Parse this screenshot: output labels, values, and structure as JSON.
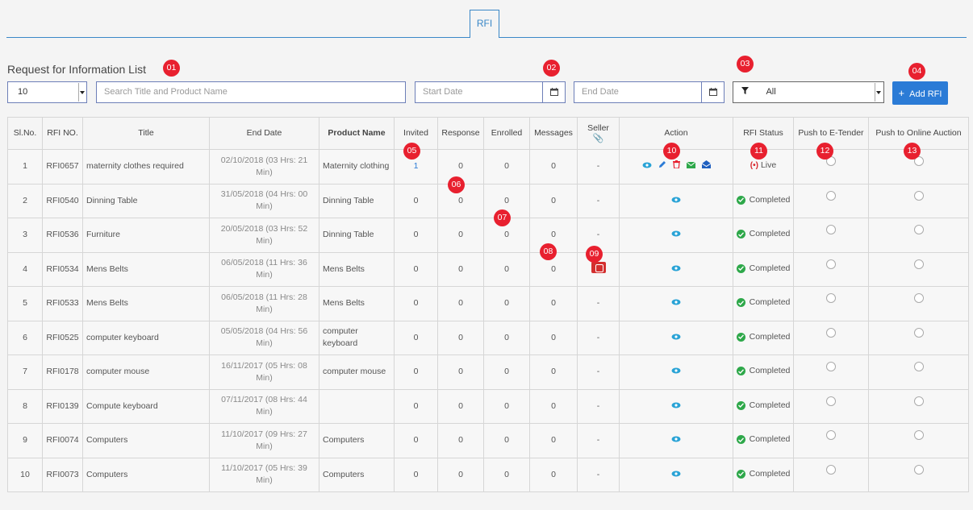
{
  "tab": {
    "label": "RFI"
  },
  "list_title": "Request for Information List",
  "controls": {
    "page_size": "10",
    "search_placeholder": "Search Title and Product Name",
    "start_placeholder": "Start Date",
    "end_placeholder": "End Date",
    "filter_value": "All",
    "add_button": "Add RFI"
  },
  "headers": {
    "slno": "Sl.No.",
    "rfi_no": "RFI NO.",
    "title": "Title",
    "end_date": "End Date",
    "product": "Product Name",
    "invited": "Invited",
    "response": "Response",
    "enrolled": "Enrolled",
    "messages": "Messages",
    "seller": "Seller",
    "action": "Action",
    "status": "RFI Status",
    "push_etender": "Push to E-Tender",
    "push_auction": "Push to Online Auction"
  },
  "rows": [
    {
      "sl": "1",
      "rfi": "RFI0657",
      "title": "maternity clothes required",
      "end": "02/10/2018 (03 Hrs: 21 Min)",
      "product": "Maternity clothing",
      "invited": "1",
      "response": "0",
      "enrolled": "0",
      "messages": "0",
      "seller": "-",
      "status": "Live"
    },
    {
      "sl": "2",
      "rfi": "RFI0540",
      "title": "Dinning Table",
      "end": "31/05/2018 (04 Hrs: 00 Min)",
      "product": "Dinning Table",
      "invited": "0",
      "response": "0",
      "enrolled": "0",
      "messages": "0",
      "seller": "-",
      "status": "Completed"
    },
    {
      "sl": "3",
      "rfi": "RFI0536",
      "title": "Furniture",
      "end": "20/05/2018 (03 Hrs: 52 Min)",
      "product": "Dinning Table",
      "invited": "0",
      "response": "0",
      "enrolled": "0",
      "messages": "0",
      "seller": "-",
      "status": "Completed"
    },
    {
      "sl": "4",
      "rfi": "RFI0534",
      "title": "Mens Belts",
      "end": "06/05/2018 (11 Hrs: 36 Min)",
      "product": "Mens Belts",
      "invited": "0",
      "response": "0",
      "enrolled": "0",
      "messages": "0",
      "seller": "",
      "status": "Completed"
    },
    {
      "sl": "5",
      "rfi": "RFI0533",
      "title": "Mens Belts",
      "end": "06/05/2018 (11 Hrs: 28 Min)",
      "product": "Mens Belts",
      "invited": "0",
      "response": "0",
      "enrolled": "0",
      "messages": "0",
      "seller": "-",
      "status": "Completed"
    },
    {
      "sl": "6",
      "rfi": "RFI0525",
      "title": "computer keyboard",
      "end": "05/05/2018 (04 Hrs: 56 Min)",
      "product": "computer keyboard",
      "invited": "0",
      "response": "0",
      "enrolled": "0",
      "messages": "0",
      "seller": "-",
      "status": "Completed"
    },
    {
      "sl": "7",
      "rfi": "RFI0178",
      "title": "computer mouse",
      "end": "16/11/2017 (05 Hrs: 08 Min)",
      "product": "computer mouse",
      "invited": "0",
      "response": "0",
      "enrolled": "0",
      "messages": "0",
      "seller": "-",
      "status": "Completed"
    },
    {
      "sl": "8",
      "rfi": "RFI0139",
      "title": "Compute keyboard",
      "end": "07/11/2017 (08 Hrs: 44 Min)",
      "product": "",
      "invited": "0",
      "response": "0",
      "enrolled": "0",
      "messages": "0",
      "seller": "-",
      "status": "Completed"
    },
    {
      "sl": "9",
      "rfi": "RFI0074",
      "title": "Computers",
      "end": "11/10/2017 (09 Hrs: 27 Min)",
      "product": "Computers",
      "invited": "0",
      "response": "0",
      "enrolled": "0",
      "messages": "0",
      "seller": "-",
      "status": "Completed"
    },
    {
      "sl": "10",
      "rfi": "RFI0073",
      "title": "Computers",
      "end": "11/10/2017 (05 Hrs: 39 Min)",
      "product": "Computers",
      "invited": "0",
      "response": "0",
      "enrolled": "0",
      "messages": "0",
      "seller": "-",
      "status": "Completed"
    }
  ],
  "markers": [
    "01",
    "02",
    "03",
    "04",
    "05",
    "06",
    "07",
    "08",
    "09",
    "10",
    "11",
    "12",
    "13"
  ],
  "colors": {
    "accent": "#2b7bd6",
    "marker": "#e8202f",
    "completed": "#2ea84a",
    "live": "#d8282e"
  }
}
